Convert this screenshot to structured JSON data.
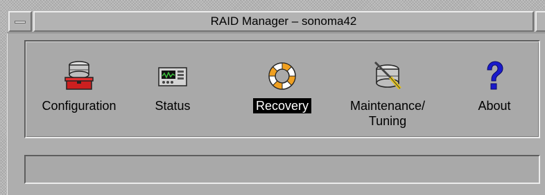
{
  "window": {
    "title": "RAID Manager – sonoma42",
    "menu_icon": "window-menu-icon",
    "maximize_icon": "window-maximize-icon"
  },
  "toolbar": {
    "items": [
      {
        "label": "Configuration",
        "icon": "configuration-icon",
        "selected": false
      },
      {
        "label": "Status",
        "icon": "status-monitor-icon",
        "selected": false
      },
      {
        "label": "Recovery",
        "icon": "life-ring-icon",
        "selected": true
      },
      {
        "label_line1": "Maintenance/",
        "label_line2": "Tuning",
        "icon": "maintenance-tuning-icon",
        "selected": false
      },
      {
        "label": "About",
        "icon": "question-mark-icon",
        "selected": false
      }
    ]
  },
  "status_bar": {
    "text": ""
  },
  "colors": {
    "selected_bg": "#000000",
    "selected_fg": "#ffffff",
    "panel_bg": "#a9a9a9",
    "config_red": "#cc1f1f",
    "about_blue": "#1a1acc",
    "status_green": "#3cc23c"
  }
}
